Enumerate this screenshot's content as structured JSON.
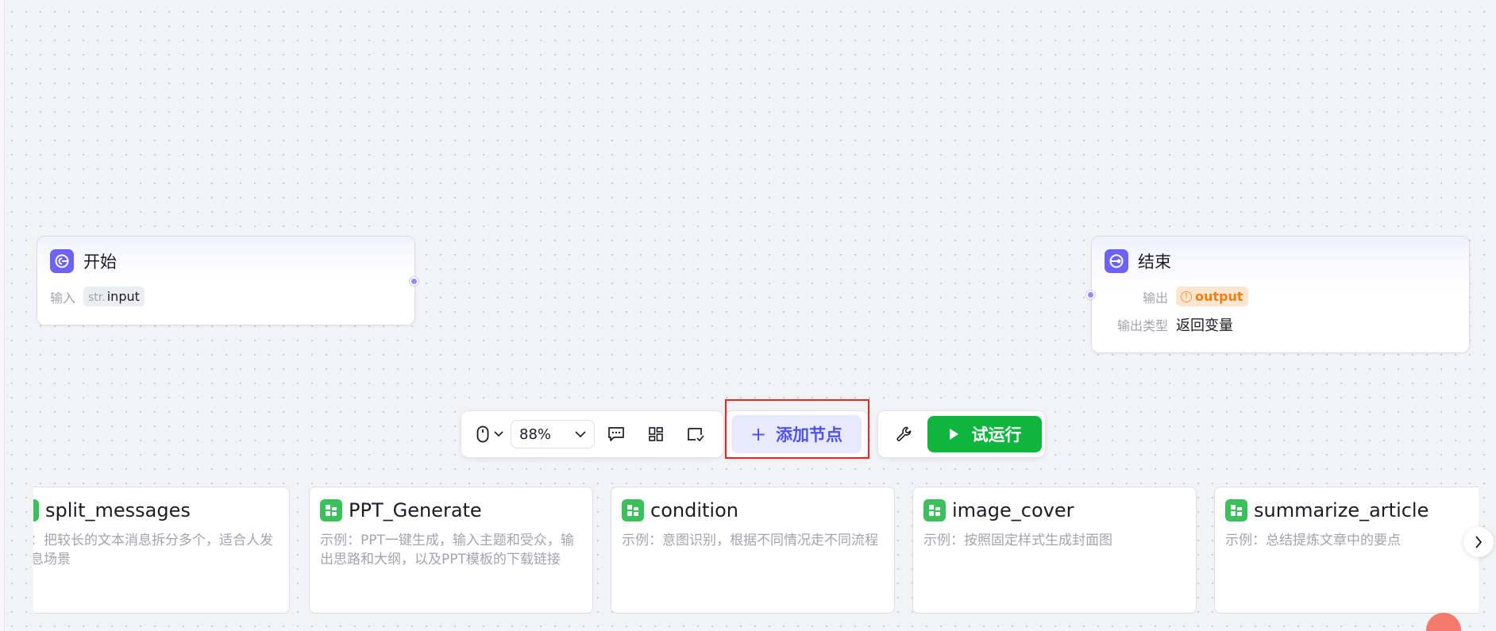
{
  "start_node": {
    "title": "开始",
    "input_label": "输入",
    "input_type": "str.",
    "input_name": "input",
    "icon": "start-node-icon"
  },
  "end_node": {
    "title": "结束",
    "output_label": "输出",
    "output_name": "output",
    "output_type_label": "输出类型",
    "output_type_value": "返回变量",
    "icon": "end-node-icon"
  },
  "toolbar": {
    "zoom": "88%",
    "add_node_label": "添加节点",
    "run_label": "试运行",
    "icons": [
      "mouse-icon",
      "comment-icon",
      "layout-icon",
      "minimap-icon",
      "wrench-icon",
      "play-icon"
    ]
  },
  "plugin_cards": [
    {
      "title": "split_messages",
      "desc": "例：把较长的文本消息拆分多个，适合人发消息场景"
    },
    {
      "title": "PPT_Generate",
      "desc": "示例：PPT一键生成，输入主题和受众，输出思路和大纲，以及PPT模板的下载链接"
    },
    {
      "title": "condition",
      "desc": "示例：意图识别，根据不同情况走不同流程"
    },
    {
      "title": "image_cover",
      "desc": "示例：按照固定样式生成封面图"
    },
    {
      "title": "summarize_article",
      "desc": "示例：总结提炼文章中的要点"
    }
  ],
  "colors": {
    "accent": "#4d53e8",
    "run": "#10b53e",
    "highlight": "#e6261f",
    "card_icon": "#3bc05c",
    "warning": "#f07f12"
  }
}
